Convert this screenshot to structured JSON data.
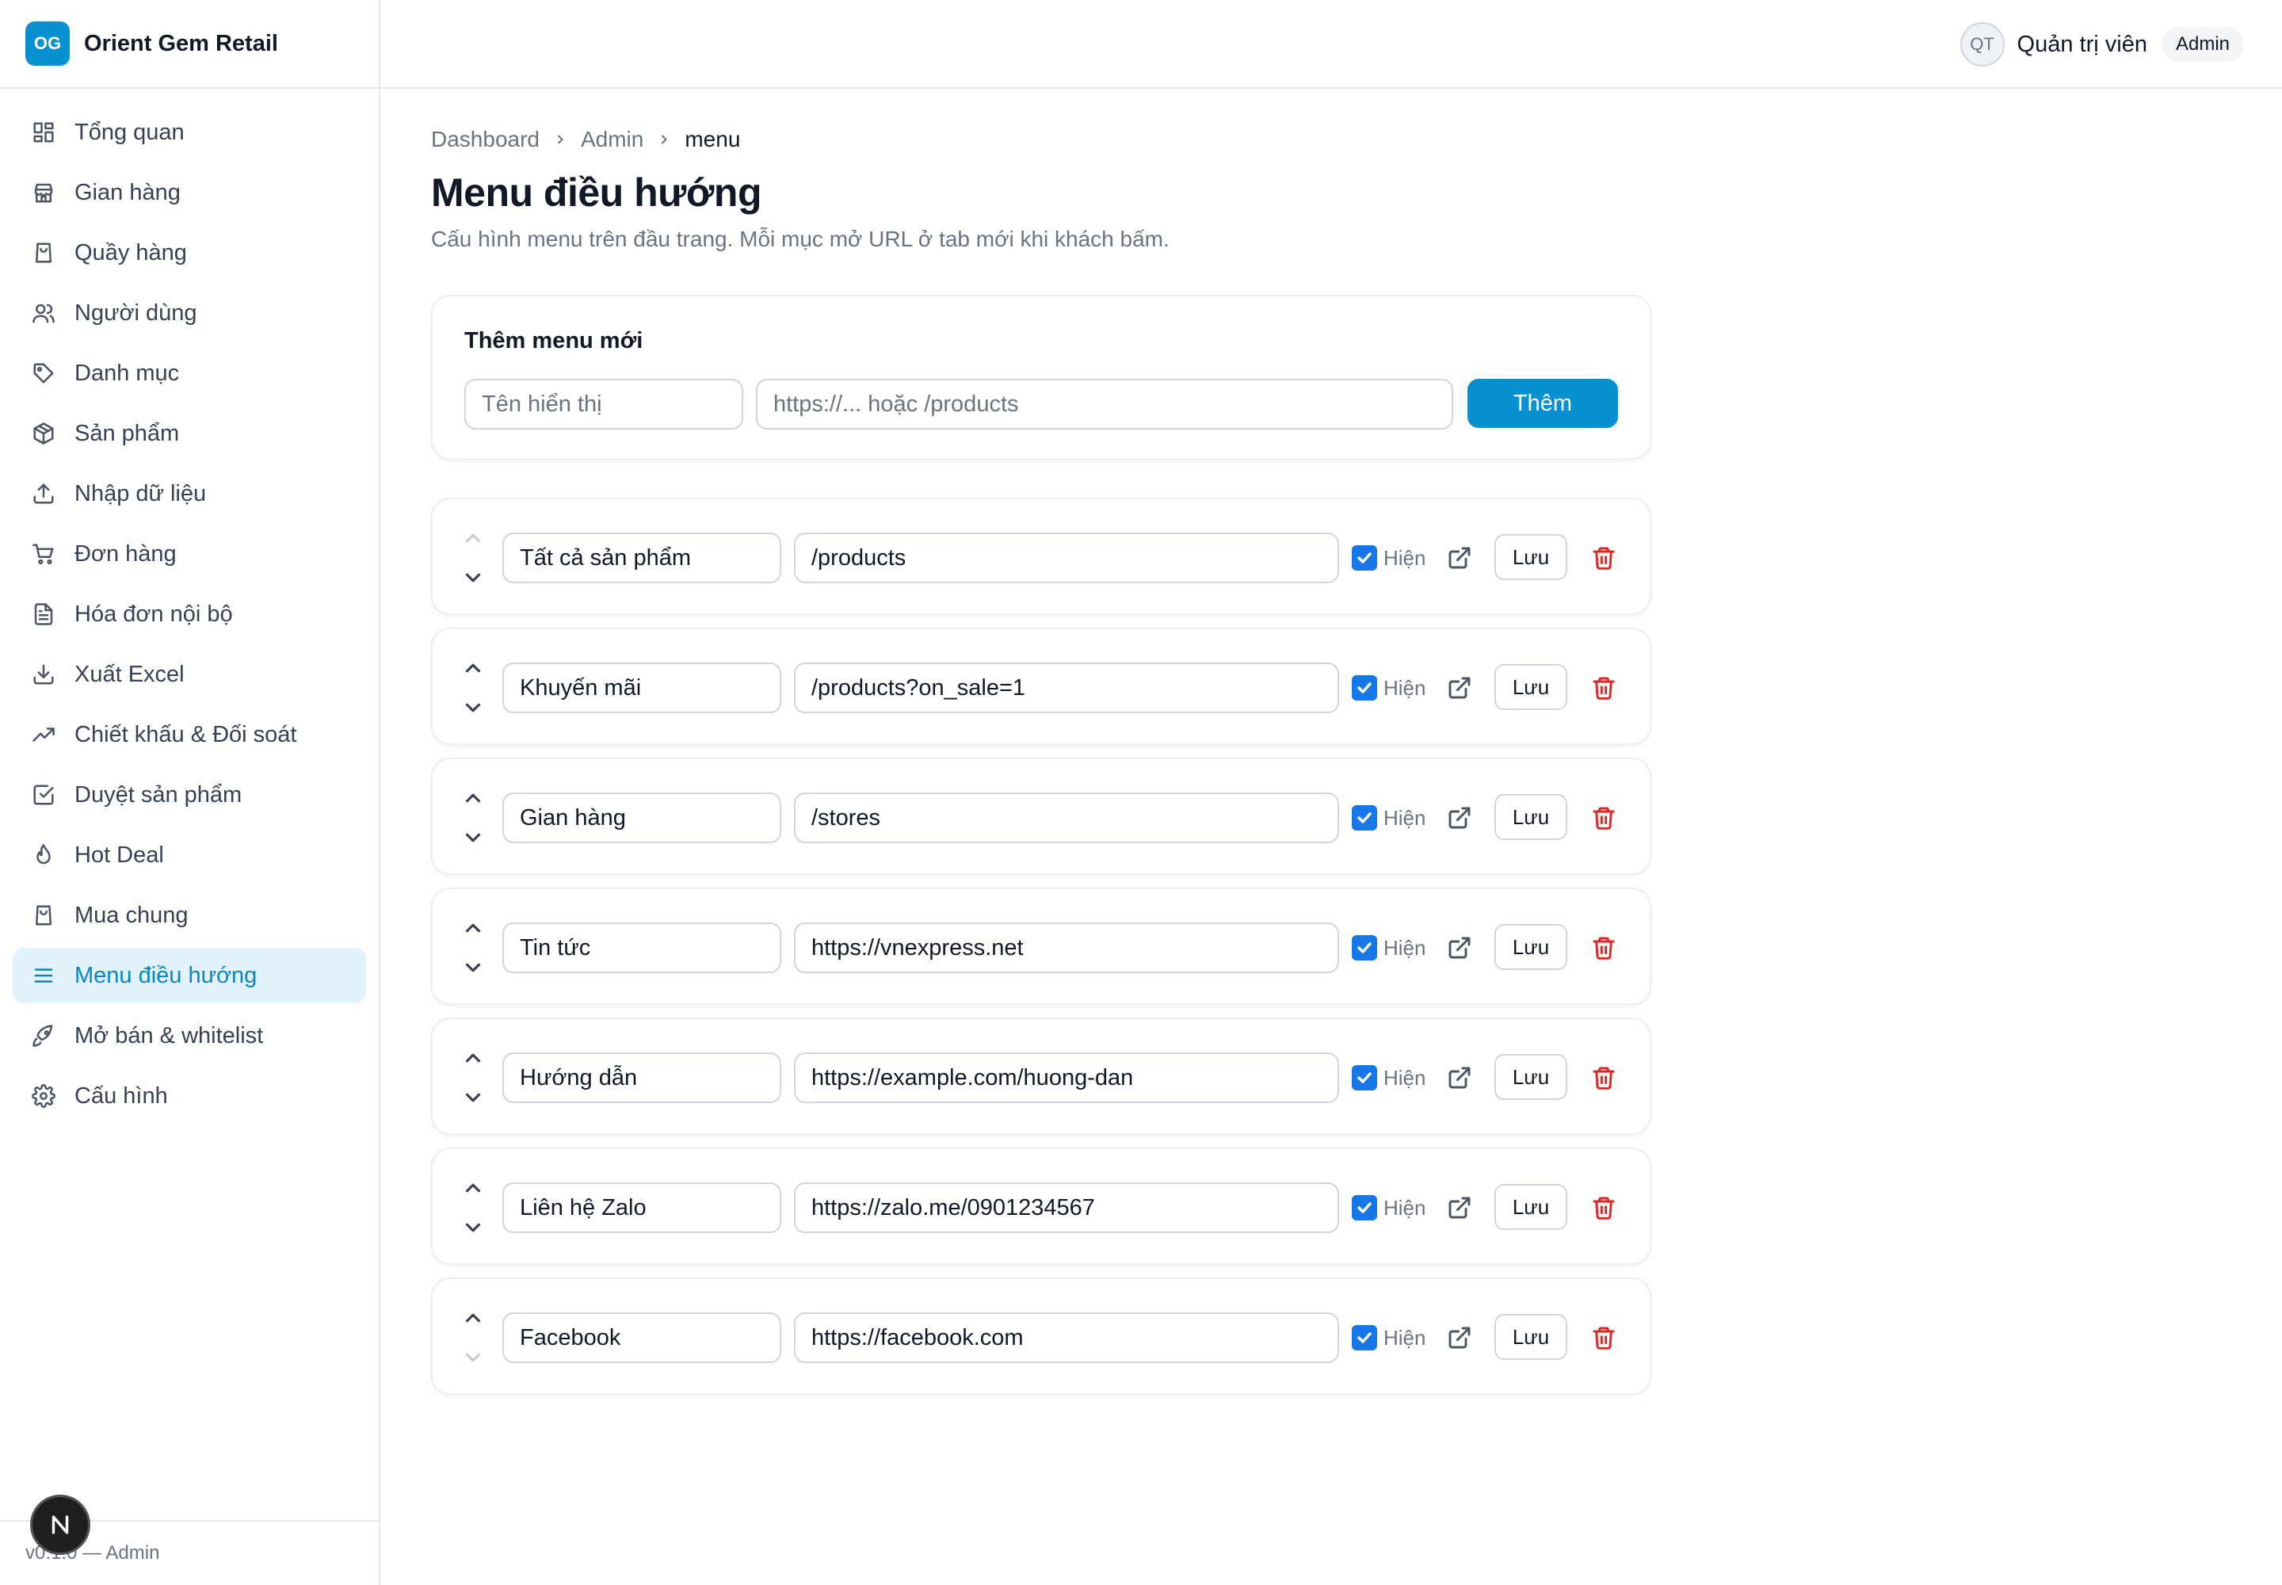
{
  "brand": {
    "logo_text": "OG",
    "name": "Orient Gem Retail"
  },
  "sidebar": {
    "items": [
      {
        "label": "Tổng quan",
        "icon": "dashboard-icon"
      },
      {
        "label": "Gian hàng",
        "icon": "store-icon"
      },
      {
        "label": "Quầy hàng",
        "icon": "shopping-bag-icon"
      },
      {
        "label": "Người dùng",
        "icon": "users-icon"
      },
      {
        "label": "Danh mục",
        "icon": "tag-icon"
      },
      {
        "label": "Sản phẩm",
        "icon": "package-icon"
      },
      {
        "label": "Nhập dữ liệu",
        "icon": "upload-icon"
      },
      {
        "label": "Đơn hàng",
        "icon": "cart-icon"
      },
      {
        "label": "Hóa đơn nội bộ",
        "icon": "file-text-icon"
      },
      {
        "label": "Xuất Excel",
        "icon": "download-icon"
      },
      {
        "label": "Chiết khấu & Đối soát",
        "icon": "trending-up-icon"
      },
      {
        "label": "Duyệt sản phẩm",
        "icon": "check-square-icon"
      },
      {
        "label": "Hot Deal",
        "icon": "flame-icon"
      },
      {
        "label": "Mua chung",
        "icon": "shopping-bag-icon"
      },
      {
        "label": "Menu điều hướng",
        "icon": "menu-icon",
        "active": true
      },
      {
        "label": "Mở bán & whitelist",
        "icon": "rocket-icon"
      },
      {
        "label": "Cấu hình",
        "icon": "settings-icon"
      }
    ],
    "footer": "v0.1.0 — Admin"
  },
  "topbar": {
    "avatar_initials": "QT",
    "user_name": "Quản trị viên",
    "role": "Admin"
  },
  "breadcrumb": {
    "items": [
      "Dashboard",
      "Admin",
      "menu"
    ]
  },
  "page": {
    "title": "Menu điều hướng",
    "description": "Cấu hình menu trên đầu trang. Mỗi mục mở URL ở tab mới khi khách bấm."
  },
  "add_form": {
    "title": "Thêm menu mới",
    "name_placeholder": "Tên hiển thị",
    "url_placeholder": "https://... hoặc /products",
    "submit_label": "Thêm"
  },
  "menu_items": [
    {
      "name": "Tất cả sản phẩm",
      "url": "/products",
      "visible": true
    },
    {
      "name": "Khuyến mãi",
      "url": "/products?on_sale=1",
      "visible": true
    },
    {
      "name": "Gian hàng",
      "url": "/stores",
      "visible": true
    },
    {
      "name": "Tin tức",
      "url": "https://vnexpress.net",
      "visible": true
    },
    {
      "name": "Hướng dẫn",
      "url": "https://example.com/huong-dan",
      "visible": true
    },
    {
      "name": "Liên hệ Zalo",
      "url": "https://zalo.me/0901234567",
      "visible": true
    },
    {
      "name": "Facebook",
      "url": "https://facebook.com",
      "visible": true
    }
  ],
  "row_labels": {
    "visible_label": "Hiện",
    "save_label": "Lưu"
  },
  "colors": {
    "accent": "#0891d1",
    "active_bg": "#e0f2fa",
    "danger": "#dc2626",
    "checkbox": "#1677e8"
  }
}
